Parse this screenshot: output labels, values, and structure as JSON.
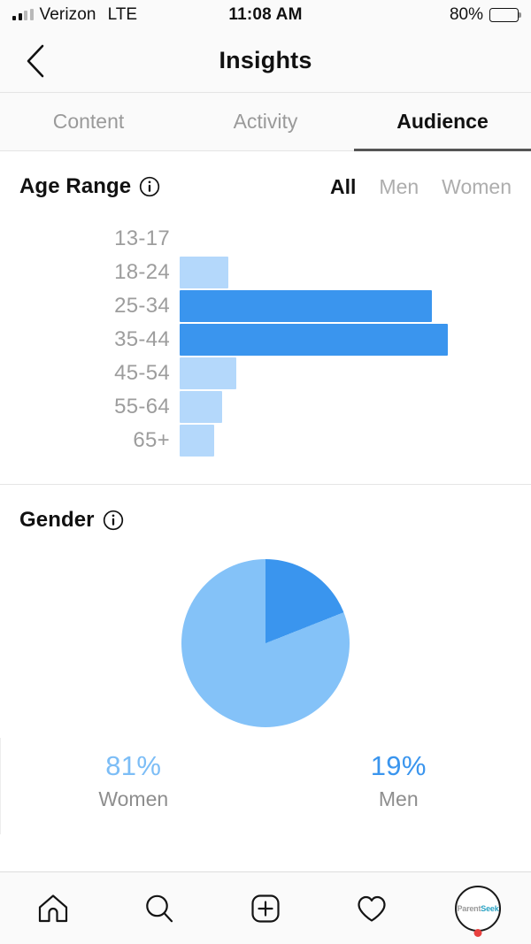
{
  "status_bar": {
    "carrier": "Verizon",
    "network": "LTE",
    "time": "11:08 AM",
    "battery_percent": "80%",
    "battery_level": 80,
    "signal_bars_filled": 2,
    "signal_bars_total": 4
  },
  "nav": {
    "title": "Insights",
    "back_icon": "chevron-left-icon"
  },
  "tabs": [
    {
      "label": "Content",
      "active": false
    },
    {
      "label": "Activity",
      "active": false
    },
    {
      "label": "Audience",
      "active": true
    }
  ],
  "age_section": {
    "title": "Age Range",
    "info_icon": "info-icon",
    "filters": [
      {
        "label": "All",
        "active": true
      },
      {
        "label": "Men",
        "active": false
      },
      {
        "label": "Women",
        "active": false
      }
    ]
  },
  "gender_section": {
    "title": "Gender",
    "info_icon": "info-icon"
  },
  "colors": {
    "bar_light": "#b4d8fb",
    "bar_dark": "#3a95ee",
    "pie_women": "#84c2f8",
    "pie_men": "#3a95ee",
    "accent_text_women": "#7cbdf6",
    "accent_text_men": "#3a95ee"
  },
  "chart_data": [
    {
      "type": "bar",
      "title": "Age Range",
      "orientation": "horizontal",
      "xlabel": "",
      "ylabel": "",
      "grid": false,
      "categories": [
        "13-17",
        "18-24",
        "25-34",
        "35-44",
        "45-54",
        "55-64",
        "65+"
      ],
      "values": [
        0,
        18,
        94,
        100,
        21,
        16,
        13
      ],
      "bar_colors": [
        "#b4d8fb",
        "#b4d8fb",
        "#3a95ee",
        "#3a95ee",
        "#b4d8fb",
        "#b4d8fb",
        "#b4d8fb"
      ],
      "value_unit": "relative percent of max",
      "legend": "none"
    },
    {
      "type": "pie",
      "title": "Gender",
      "labels": [
        "Women",
        "Men"
      ],
      "values": [
        81,
        19
      ],
      "display_values": [
        "81%",
        "19%"
      ],
      "colors": [
        "#84c2f8",
        "#3a95ee"
      ],
      "start_angle_deg": 0,
      "direction": "clockwise",
      "legend": "bottom"
    }
  ],
  "bottom_nav": [
    {
      "icon": "home-icon",
      "label": "Home"
    },
    {
      "icon": "search-icon",
      "label": "Search"
    },
    {
      "icon": "add-post-icon",
      "label": "New Post"
    },
    {
      "icon": "heart-icon",
      "label": "Activity"
    },
    {
      "icon": "profile-avatar-icon",
      "label": "Profile"
    }
  ],
  "profile": {
    "logo_primary": "Parent",
    "logo_secondary": "Seek",
    "has_notification": true
  }
}
